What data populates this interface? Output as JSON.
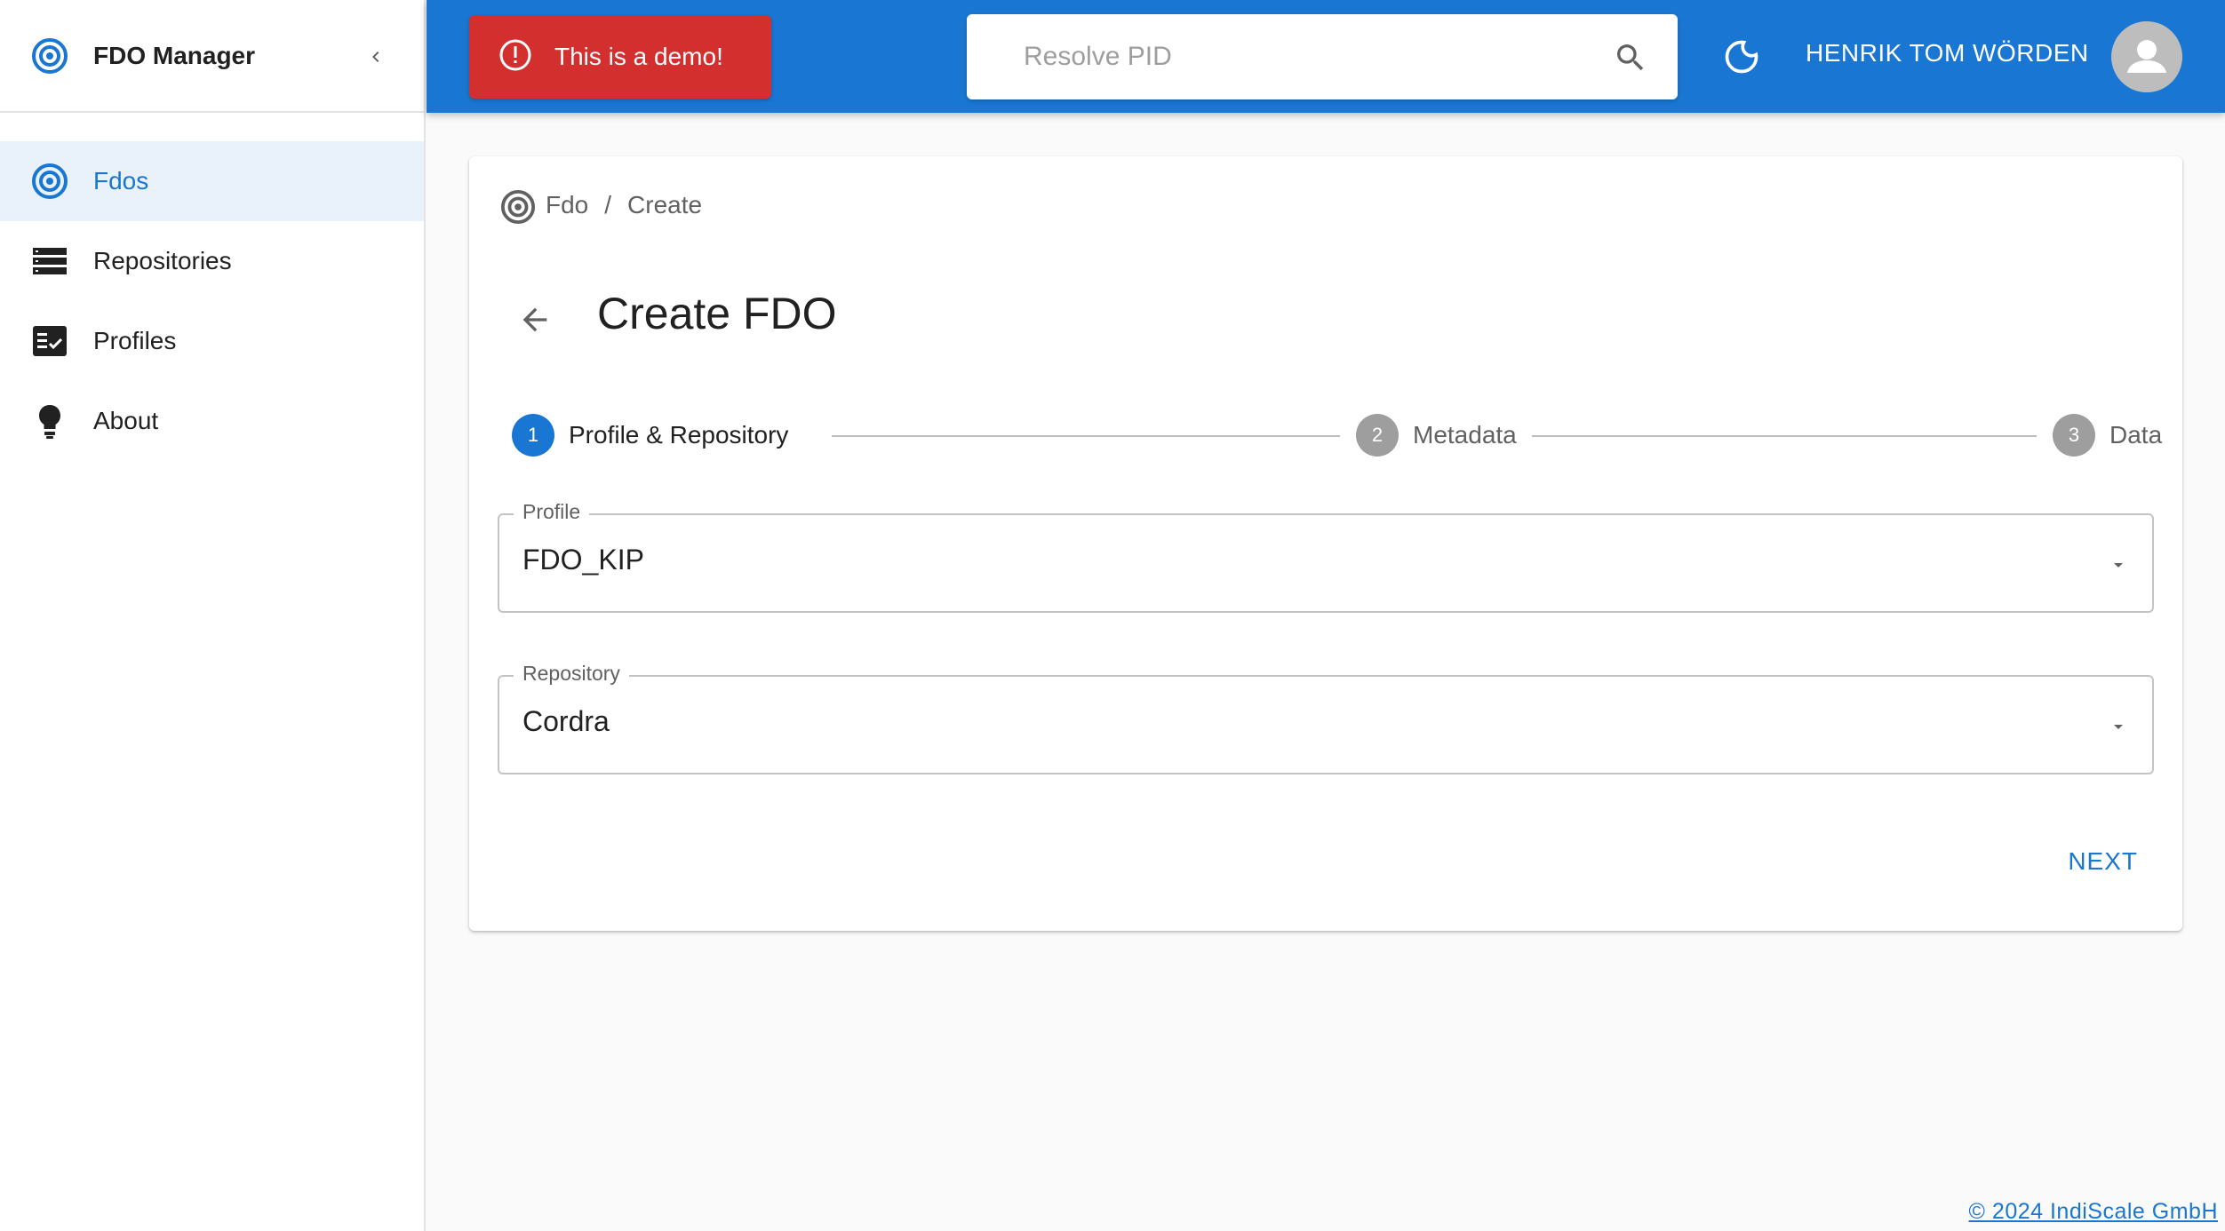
{
  "sidebar": {
    "brand": "FDO Manager",
    "items": [
      {
        "label": "Fdos",
        "icon": "target-icon",
        "active": true
      },
      {
        "label": "Repositories",
        "icon": "storage-icon",
        "active": false
      },
      {
        "label": "Profiles",
        "icon": "checklist-icon",
        "active": false
      },
      {
        "label": "About",
        "icon": "lightbulb-icon",
        "active": false
      }
    ]
  },
  "topbar": {
    "alert": "This is a demo!",
    "search_placeholder": "Resolve PID",
    "user_name": "HENRIK TOM WÖRDEN"
  },
  "breadcrumb": {
    "root": "Fdo",
    "separator": "/",
    "current": "Create"
  },
  "page": {
    "title": "Create FDO"
  },
  "stepper": {
    "steps": [
      {
        "number": "1",
        "label": "Profile & Repository",
        "active": true
      },
      {
        "number": "2",
        "label": "Metadata",
        "active": false
      },
      {
        "number": "3",
        "label": "Data",
        "active": false
      }
    ]
  },
  "form": {
    "profile": {
      "label": "Profile",
      "value": "FDO_KIP"
    },
    "repository": {
      "label": "Repository",
      "value": "Cordra"
    },
    "next_label": "NEXT"
  },
  "footer": {
    "text": "© 2024 IndiScale GmbH"
  },
  "colors": {
    "primary": "#1976d2",
    "alert": "#d32f2f",
    "active_nav_bg": "#e9f1fb"
  }
}
